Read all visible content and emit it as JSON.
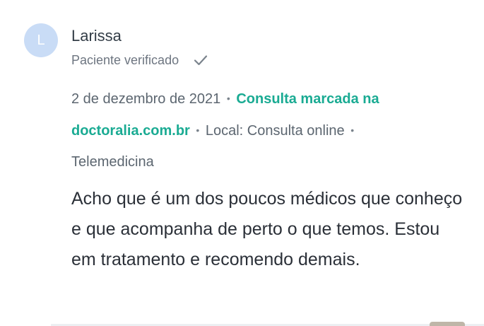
{
  "review": {
    "avatar_letter": "L",
    "author": "Larissa",
    "verified_label": "Paciente verificado",
    "date": "2 de dezembro de 2021",
    "separator": "•",
    "booking_line_1": "Consulta marcada na",
    "booking_line_2": "doctoralia.com.br",
    "location": "Local: Consulta online",
    "service": "Telemedicina",
    "text": "Acho que é um dos poucos médicos que conheço e que acompanha de perto o que temos. Estou em tratamento e recomendo demais."
  },
  "colors": {
    "avatar_bg": "#c9dcf6",
    "link": "#1aab93",
    "text": "#2b3038",
    "muted": "#6d7580"
  },
  "icons": {
    "verified": "check-icon"
  }
}
